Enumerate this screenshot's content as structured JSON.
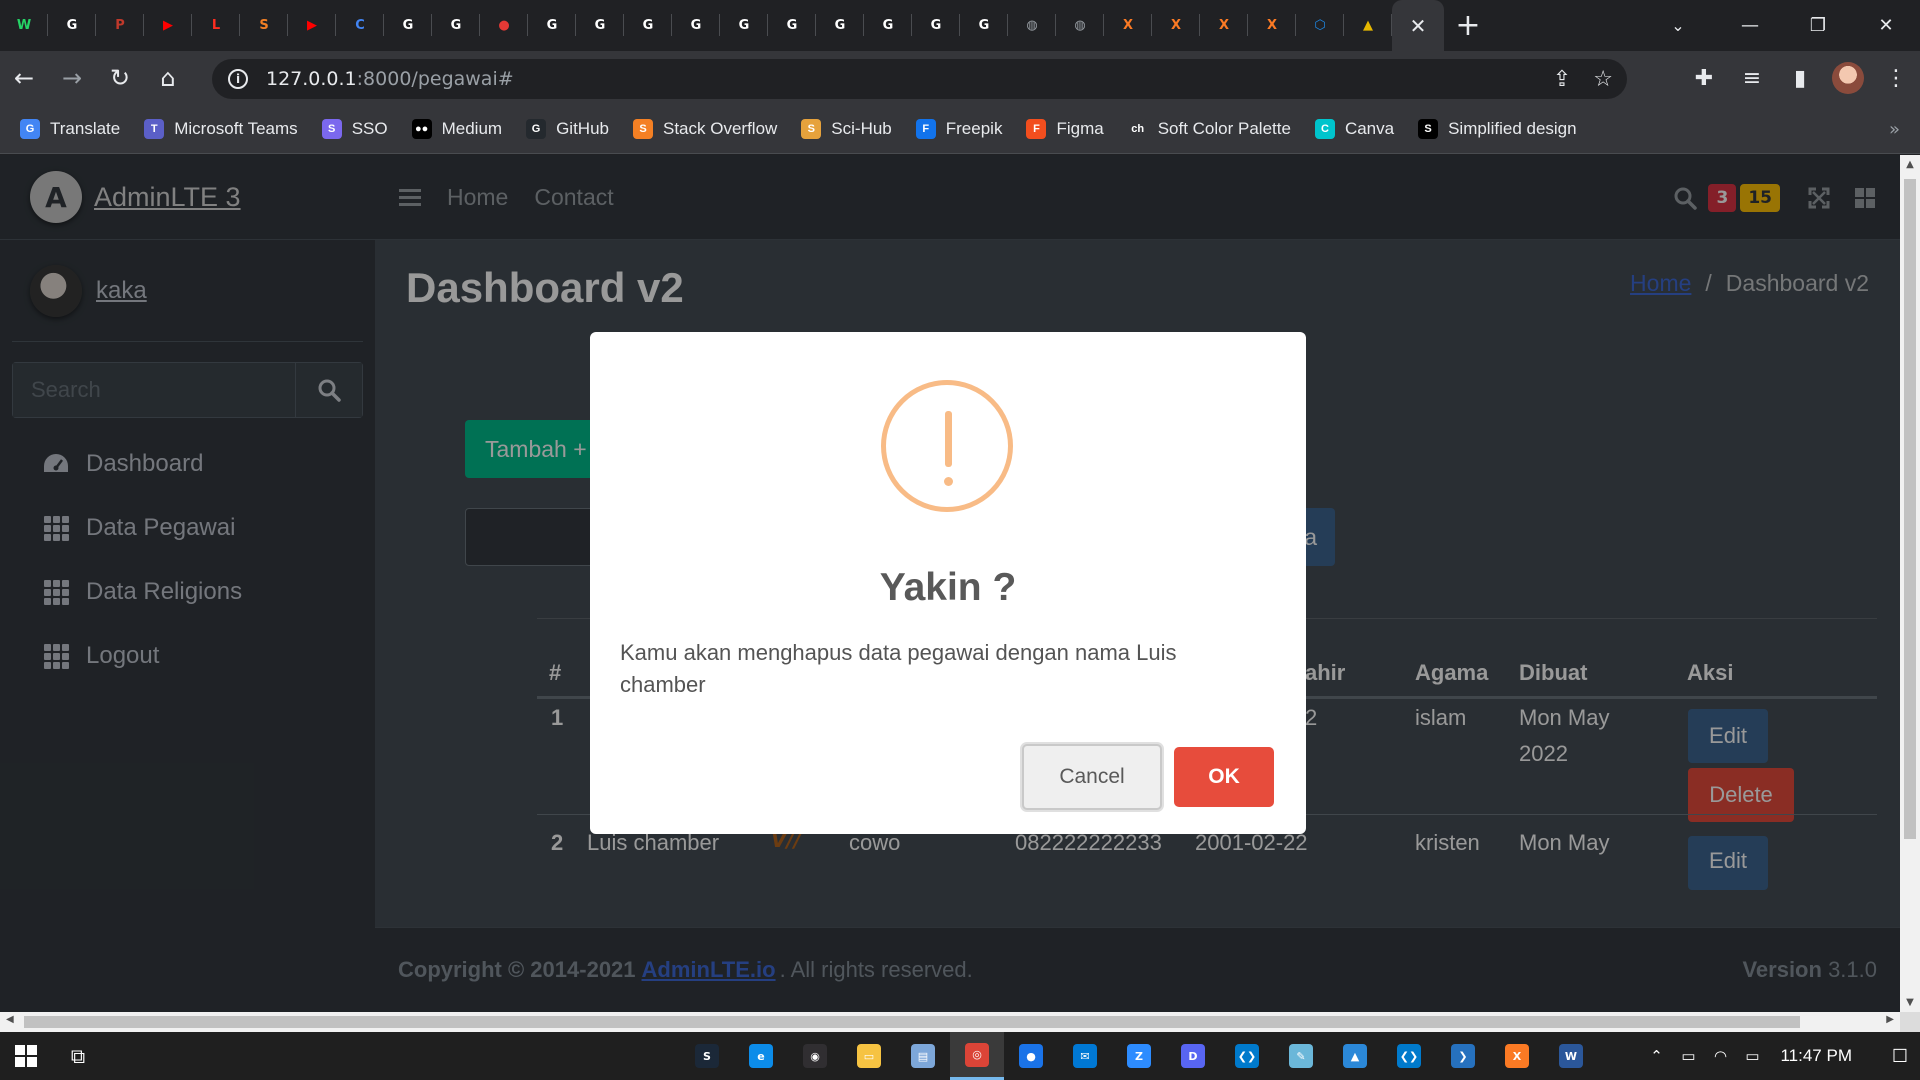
{
  "browser": {
    "tabs": [
      {
        "icon": "whatsapp-icon",
        "color": "#25d366",
        "glyph": "W"
      },
      {
        "icon": "github-icon",
        "color": "#ffffff",
        "glyph": "G"
      },
      {
        "icon": "avatar-tab-icon",
        "color": "#c0392b",
        "glyph": "P"
      },
      {
        "icon": "youtube-icon",
        "color": "#ff0000",
        "glyph": "▶"
      },
      {
        "icon": "laravel-icon",
        "color": "#ff2d20",
        "glyph": "L"
      },
      {
        "icon": "stackoverflow-icon",
        "color": "#f48024",
        "glyph": "S"
      },
      {
        "icon": "youtube-icon",
        "color": "#ff0000",
        "glyph": "▶"
      },
      {
        "icon": "contacts-icon",
        "color": "#4285f4",
        "glyph": "C"
      },
      {
        "icon": "github-icon",
        "color": "#ffffff",
        "glyph": "G"
      },
      {
        "icon": "github-icon",
        "color": "#ffffff",
        "glyph": "G"
      },
      {
        "icon": "record-icon",
        "color": "#e53935",
        "glyph": "●"
      },
      {
        "icon": "google-icon",
        "color": "#ffffff",
        "glyph": "G"
      },
      {
        "icon": "google-icon",
        "color": "#ffffff",
        "glyph": "G"
      },
      {
        "icon": "google-icon",
        "color": "#ffffff",
        "glyph": "G"
      },
      {
        "icon": "google-icon",
        "color": "#ffffff",
        "glyph": "G"
      },
      {
        "icon": "google-icon",
        "color": "#ffffff",
        "glyph": "G"
      },
      {
        "icon": "google-icon",
        "color": "#ffffff",
        "glyph": "G"
      },
      {
        "icon": "google-icon",
        "color": "#ffffff",
        "glyph": "G"
      },
      {
        "icon": "google-icon",
        "color": "#ffffff",
        "glyph": "G"
      },
      {
        "icon": "google-icon",
        "color": "#ffffff",
        "glyph": "G"
      },
      {
        "icon": "google-icon",
        "color": "#ffffff",
        "glyph": "G"
      },
      {
        "icon": "globe-icon",
        "color": "#9aa0a6",
        "glyph": "◍"
      },
      {
        "icon": "globe-icon",
        "color": "#9aa0a6",
        "glyph": "◍"
      },
      {
        "icon": "xampp-icon",
        "color": "#fb7a24",
        "glyph": "X"
      },
      {
        "icon": "xampp-icon",
        "color": "#fb7a24",
        "glyph": "X"
      },
      {
        "icon": "xampp-icon",
        "color": "#fb7a24",
        "glyph": "X"
      },
      {
        "icon": "xampp-icon",
        "color": "#fb7a24",
        "glyph": "X"
      },
      {
        "icon": "hex-icon",
        "color": "#1e88e5",
        "glyph": "⬡"
      },
      {
        "icon": "mountain-icon",
        "color": "#e6b800",
        "glyph": "▲"
      }
    ],
    "url_host": "127.0.0.1",
    "url_rest": ":8000/pegawai#",
    "bookmarks": [
      {
        "label": "Translate",
        "icon": "translate-icon",
        "color": "#4285f4",
        "glyph": "G"
      },
      {
        "label": "Microsoft Teams",
        "icon": "teams-icon",
        "color": "#5b5fc7",
        "glyph": "T"
      },
      {
        "label": "SSO",
        "icon": "sso-icon",
        "color": "#7b68ee",
        "glyph": "S"
      },
      {
        "label": "Medium",
        "icon": "medium-icon",
        "color": "#000000",
        "glyph": "●●"
      },
      {
        "label": "GitHub",
        "icon": "github-icon",
        "color": "#24292e",
        "glyph": "G"
      },
      {
        "label": "Stack Overflow",
        "icon": "stackoverflow-icon",
        "color": "#f48024",
        "glyph": "S"
      },
      {
        "label": "Sci-Hub",
        "icon": "scihub-icon",
        "color": "#e6a23c",
        "glyph": "S"
      },
      {
        "label": "Freepik",
        "icon": "freepik-icon",
        "color": "#1273eb",
        "glyph": "F"
      },
      {
        "label": "Figma",
        "icon": "figma-icon",
        "color": "#f24e1e",
        "glyph": "F"
      },
      {
        "label": "Soft Color Palette",
        "icon": "palette-icon",
        "color": "#35363a",
        "glyph": "ch"
      },
      {
        "label": "Canva",
        "icon": "canva-icon",
        "color": "#00c4cc",
        "glyph": "C"
      },
      {
        "label": "Simplified design",
        "icon": "simplified-icon",
        "color": "#000000",
        "glyph": "S"
      }
    ]
  },
  "app": {
    "brand": "AdminLTE 3",
    "brand_logo": "A",
    "user": "kaka",
    "search_placeholder": "Search",
    "nav": [
      {
        "label": "Dashboard",
        "icon": "tachometer-icon"
      },
      {
        "label": "Data Pegawai",
        "icon": "grid-icon"
      },
      {
        "label": "Data Religions",
        "icon": "grid-icon"
      },
      {
        "label": "Logout",
        "icon": "grid-icon"
      }
    ],
    "header_links": [
      "Home",
      "Contact"
    ],
    "badge_red": "3",
    "badge_yellow": "15",
    "page_title": "Dashboard v2",
    "breadcrumb_home": "Home",
    "breadcrumb_sep": "/",
    "breadcrumb_current": "Dashboard v2",
    "add_button": "Tambah +",
    "search_button_partial": "a",
    "table": {
      "headers": {
        "no": "#",
        "lahir_partial": "ahir",
        "agama": "Agama",
        "dibuat": "Dibuat",
        "aksi": "Aksi"
      },
      "row1": {
        "no": "1",
        "lahir_partial": "2",
        "agama": "islam",
        "dibuat_line1": "Mon May",
        "dibuat_line2": "2022"
      },
      "row2": {
        "no": "2",
        "nama": "Luis chamber",
        "photo": "V//",
        "jk": "cowo",
        "telp": "082222222233",
        "lahir": "2001-02-22",
        "agama": "kristen",
        "dibuat": "Mon May"
      },
      "edit_label": "Edit",
      "delete_label": "Delete"
    },
    "footer": {
      "copyright": "Copyright © 2014-2021",
      "link": "AdminLTE.io",
      "rights": ". All rights reserved.",
      "version_label": "Version",
      "version": "3.1.0"
    }
  },
  "modal": {
    "title": "Yakin ?",
    "text": "Kamu akan menghapus data pegawai dengan nama Luis chamber",
    "cancel": "Cancel",
    "ok": "OK"
  },
  "taskbar": {
    "apps": [
      {
        "icon": "steam-icon",
        "color": "#1b2838",
        "glyph": "S"
      },
      {
        "icon": "edge-icon",
        "color": "#0c8ce9",
        "glyph": "e"
      },
      {
        "icon": "obs-icon",
        "color": "#302e31",
        "glyph": "◉"
      },
      {
        "icon": "file-explorer-icon",
        "color": "#f6c342",
        "glyph": "▭"
      },
      {
        "icon": "files-icon",
        "color": "#7da7d9",
        "glyph": "▤"
      },
      {
        "icon": "chrome-icon",
        "color": "#db4437",
        "glyph": "◎"
      },
      {
        "icon": "maps-icon",
        "color": "#1a73e8",
        "glyph": "●"
      },
      {
        "icon": "mail-icon",
        "color": "#0078d4",
        "glyph": "✉"
      },
      {
        "icon": "zoom-icon",
        "color": "#2d8cff",
        "glyph": "Z"
      },
      {
        "icon": "discord-icon",
        "color": "#5865f2",
        "glyph": "D"
      },
      {
        "icon": "vscode-icon",
        "color": "#007acc",
        "glyph": "❮❯"
      },
      {
        "icon": "notepad-icon",
        "color": "#6bb7d9",
        "glyph": "✎"
      },
      {
        "icon": "photo-icon",
        "color": "#2b88d8",
        "glyph": "▲"
      },
      {
        "icon": "vscode-icon",
        "color": "#007acc",
        "glyph": "❮❯"
      },
      {
        "icon": "powershell-icon",
        "color": "#2671be",
        "glyph": "❯"
      },
      {
        "icon": "xampp-icon",
        "color": "#fb7a24",
        "glyph": "X"
      },
      {
        "icon": "word-icon",
        "color": "#2b579a",
        "glyph": "W"
      }
    ],
    "clock": "11:47 PM"
  }
}
